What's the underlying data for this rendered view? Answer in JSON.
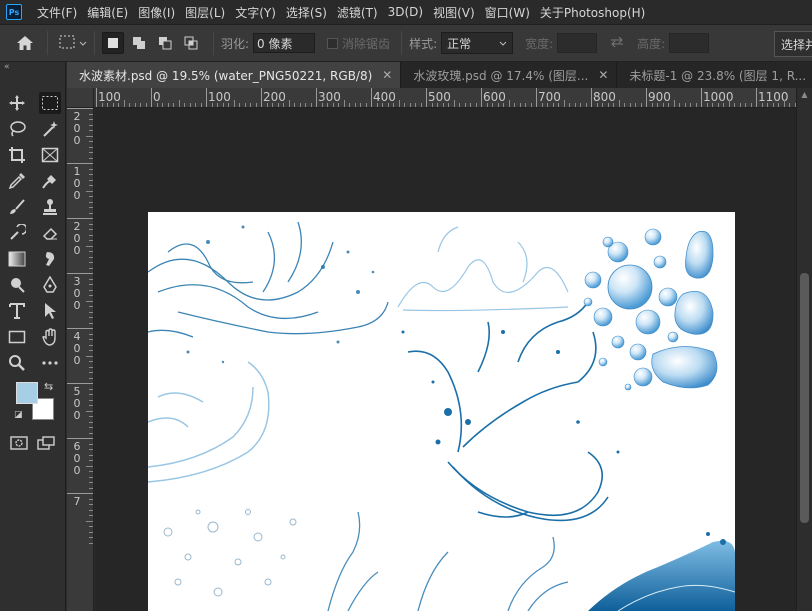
{
  "app": {
    "logo_text": "Ps"
  },
  "menu": [
    "文件(F)",
    "编辑(E)",
    "图像(I)",
    "图层(L)",
    "文字(Y)",
    "选择(S)",
    "滤镜(T)",
    "3D(D)",
    "视图(V)",
    "窗口(W)",
    "关于Photoshop(H)"
  ],
  "options": {
    "feather_label": "羽化:",
    "feather_value": "0 像素",
    "antialias_label": "消除锯齿",
    "style_label": "样式:",
    "style_value": "正常",
    "width_label": "宽度:",
    "height_label": "高度:",
    "select_subject": "选择并遮住..."
  },
  "tabs": [
    {
      "label": "水波素材.psd @ 19.5% (water_PNG50221, RGB/8)",
      "active": true
    },
    {
      "label": "水波玫瑰.psd @ 17.4% (图层...",
      "active": false
    },
    {
      "label": "未标题-1 @ 23.8% (图层 1, R...",
      "active": false
    }
  ],
  "ruler_h_labels": [
    "100",
    "0",
    "100",
    "200",
    "300",
    "400",
    "500",
    "600",
    "700",
    "800",
    "900",
    "1000",
    "1100"
  ],
  "ruler_v_labels": [
    "2\n0\n0",
    "1\n0\n0",
    "2\n0\n0",
    "3\n0\n0",
    "4\n0\n0",
    "5\n0\n0",
    "6\n0\n0",
    "7"
  ],
  "colors": {
    "foreground": "#a6cfe6",
    "background": "#ffffff",
    "water_blue": "#1b6fa8",
    "water_light": "#8fc0e0"
  },
  "icons": {
    "home": "home-icon",
    "tools": [
      "move-icon",
      "rectangular-marquee-icon",
      "lasso-icon",
      "magic-wand-icon",
      "crop-icon",
      "frame-icon",
      "eyedropper-icon",
      "healing-brush-icon",
      "brush-icon",
      "clone-stamp-icon",
      "history-brush-icon",
      "eraser-icon",
      "gradient-icon",
      "smudge-icon",
      "dodge-icon",
      "pen-icon",
      "type-icon",
      "path-selection-icon",
      "rectangle-icon",
      "hand-icon",
      "zoom-icon",
      "more-tools-icon"
    ]
  }
}
